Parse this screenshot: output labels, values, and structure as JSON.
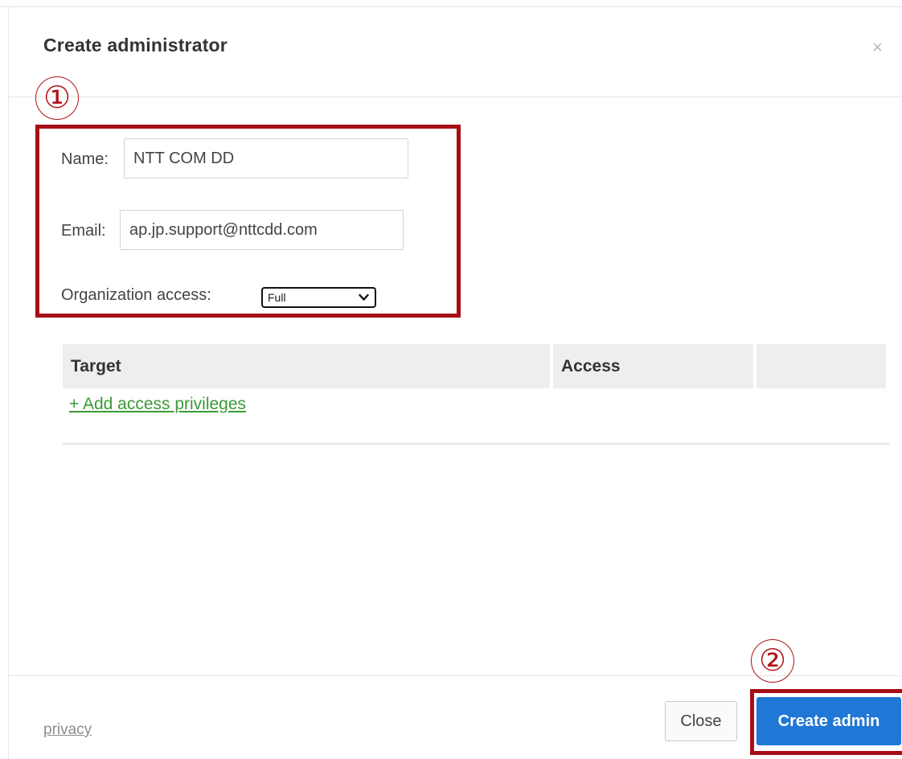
{
  "dialog": {
    "title": "Create administrator",
    "close_glyph": "×"
  },
  "annotations": {
    "step1": "①",
    "step2": "②",
    "color": "#a50f15"
  },
  "form": {
    "name_label": "Name:",
    "name_value": "NTT COM DD",
    "email_label": "Email:",
    "email_value": "ap.jp.support@nttcdd.com",
    "org_access_label": "Organization access:",
    "org_access_selected": "Full"
  },
  "table": {
    "columns": [
      "Target",
      "Access",
      ""
    ]
  },
  "add_privileges_link": "+ Add access privileges",
  "footer": {
    "privacy_link": "privacy",
    "close_button": "Close",
    "create_button": "Create admin"
  },
  "colors": {
    "primary_button": "#1f77d6",
    "link_green": "#3a9a35",
    "annotation_red": "#a50f15"
  },
  "icons": {
    "close": "close-icon",
    "dropdown": "chevron-down-icon"
  }
}
